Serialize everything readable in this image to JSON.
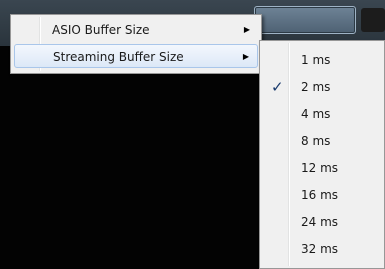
{
  "menu": {
    "items": [
      {
        "label": "ASIO Buffer Size",
        "has_submenu": true,
        "highlighted": false
      },
      {
        "label": "Streaming Buffer Size",
        "has_submenu": true,
        "highlighted": true
      }
    ],
    "arrow_icon": "triangle-right-icon"
  },
  "submenu": {
    "items": [
      {
        "label": "1 ms",
        "checked": false
      },
      {
        "label": "2 ms",
        "checked": true
      },
      {
        "label": "4 ms",
        "checked": false
      },
      {
        "label": "8 ms",
        "checked": false
      },
      {
        "label": "12 ms",
        "checked": false
      },
      {
        "label": "16 ms",
        "checked": false
      },
      {
        "label": "24 ms",
        "checked": false
      },
      {
        "label": "32 ms",
        "checked": false
      }
    ],
    "check_icon": "checkmark-icon"
  },
  "colors": {
    "menu_background": "#f0f0f0",
    "highlight_border": "#a9c6ea",
    "window_background": "#030303"
  }
}
